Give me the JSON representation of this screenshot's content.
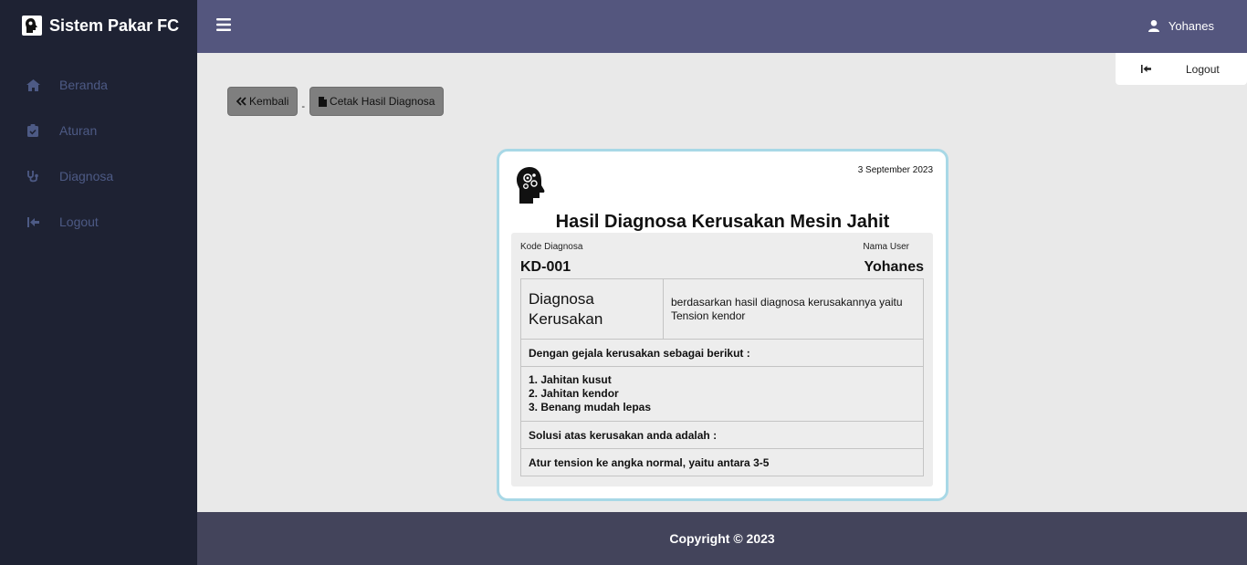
{
  "brand": {
    "title": "Sistem Pakar FC"
  },
  "sidebar": {
    "items": [
      {
        "label": "Beranda",
        "icon": "home-icon"
      },
      {
        "label": "Aturan",
        "icon": "clipboard-check-icon"
      },
      {
        "label": "Diagnosa",
        "icon": "stethoscope-icon"
      },
      {
        "label": "Logout",
        "icon": "logout-icon"
      }
    ]
  },
  "topbar": {
    "user_name": "Yohanes",
    "dropdown_logout": "Logout"
  },
  "actions": {
    "back_label": "Kembali",
    "separator": "-",
    "print_label": "Cetak Hasil Diagnosa"
  },
  "card": {
    "date": "3 September 2023",
    "title": "Hasil Diagnosa Kerusakan Mesin Jahit",
    "code_label": "Kode Diagnosa",
    "code_value": "KD-001",
    "user_label": "Nama User",
    "user_value": "Yohanes",
    "diagnosis_label": "Diagnosa Kerusakan",
    "diagnosis_text": "berdasarkan hasil diagnosa kerusakannya yaitu Tension kendor",
    "symptoms_heading": "Dengan gejala kerusakan sebagai berikut :",
    "symptoms": [
      "1. Jahitan kusut",
      "2. Jahitan kendor",
      "3. Benang mudah lepas"
    ],
    "solution_heading": "Solusi atas kerusakan anda adalah :",
    "solution_text": "Atur tension ke angka normal, yaitu antara 3-5"
  },
  "footer": {
    "copyright": "Copyright © 2023"
  },
  "colors": {
    "sidebar": "#1e2233",
    "topbar": "#54567e",
    "footer": "#43445b",
    "card_border": "#a8d8e6",
    "nav_text": "#4d5a85"
  }
}
